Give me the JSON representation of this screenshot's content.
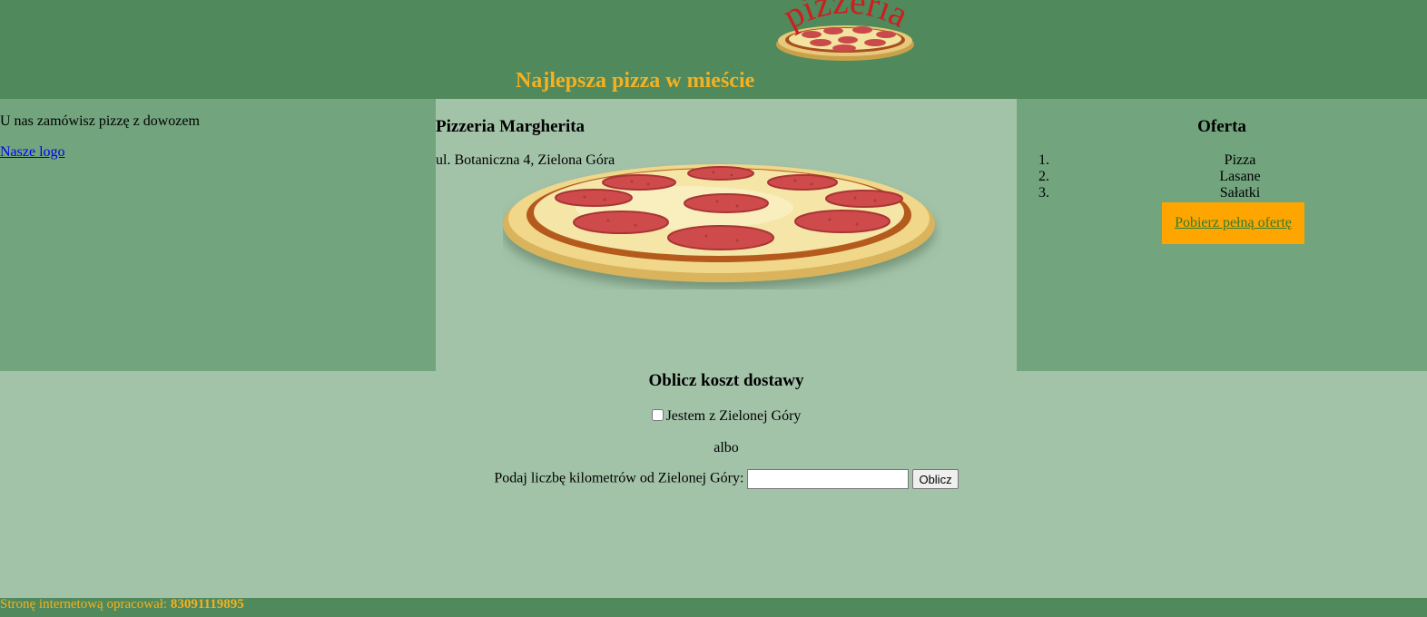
{
  "header": {
    "logo_text": "pizzeria",
    "heading": "Najlepsza pizza w mieście"
  },
  "left": {
    "intro": "U nas zamówisz pizzę z dowozem",
    "logo_link": "Nasze logo"
  },
  "center": {
    "name": "Pizzeria Margherita",
    "address": "ul. Botaniczna 4, Zielona Góra"
  },
  "offer": {
    "title": "Oferta",
    "items": [
      "Pizza",
      "Lasane",
      "Sałatki"
    ],
    "download_link": "Pobierz pełną ofertę"
  },
  "calc": {
    "title": "Oblicz koszt dostawy",
    "checkbox_label": "Jestem z Zielonej Góry",
    "or_text": "albo",
    "km_label": "Podaj liczbę kilometrów od Zielonej Góry:",
    "km_value": "",
    "button_label": "Oblicz"
  },
  "footer": {
    "text": "Stronę internetową opracował: ",
    "author_id": "83091119895"
  },
  "colors": {
    "header_bg": "#50895c",
    "side_bg": "#72a47d",
    "main_bg": "#a3c3a9",
    "accent": "#f5b120",
    "button_orange": "#ffa500"
  }
}
